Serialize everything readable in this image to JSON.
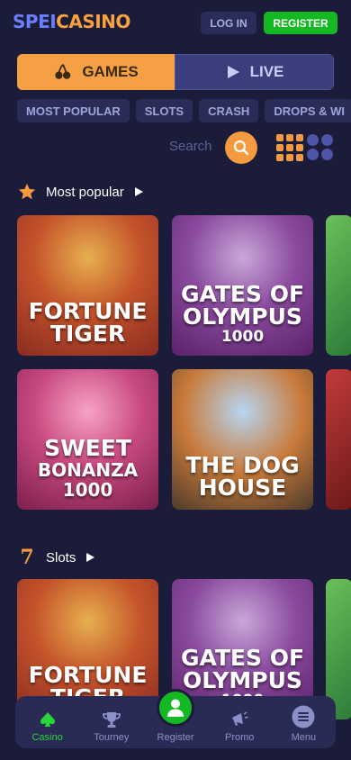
{
  "header": {
    "logo_part1": "SPEI",
    "logo_part2": "CASINO",
    "login_label": "LOG IN",
    "register_label": "REGISTER"
  },
  "mode_tabs": {
    "games_label": "GAMES",
    "live_label": "LIVE"
  },
  "categories": [
    "MOST POPULAR",
    "SLOTS",
    "CRASH",
    "DROPS & WI"
  ],
  "search": {
    "label": "Search"
  },
  "sections": [
    {
      "title": "Most popular",
      "games": [
        {
          "l1": "FORTUNE",
          "l2": "TIGER",
          "l3": ""
        },
        {
          "l1": "GATES OF",
          "l2": "OLYMPUS",
          "l3": "1000"
        },
        {
          "l1": "SWEET",
          "l2": "BONANZA",
          "l3": "1000"
        },
        {
          "l1": "THE DOG",
          "l2": "HOUSE",
          "l3": ""
        }
      ]
    },
    {
      "title": "Slots",
      "games": [
        {
          "l1": "FORTUNE",
          "l2": "TIGER",
          "l3": ""
        },
        {
          "l1": "GATES OF",
          "l2": "OLYMPUS",
          "l3": "1000"
        }
      ]
    }
  ],
  "bottom_nav": {
    "items": [
      {
        "label": "Casino"
      },
      {
        "label": "Tourney"
      },
      {
        "label": "Register"
      },
      {
        "label": "Promo"
      },
      {
        "label": "Menu"
      }
    ]
  },
  "colors": {
    "background": "#1b1b3a",
    "accent_orange": "#f59a3e",
    "accent_green": "#14b823",
    "tab_inactive": "#3b3e7a"
  }
}
